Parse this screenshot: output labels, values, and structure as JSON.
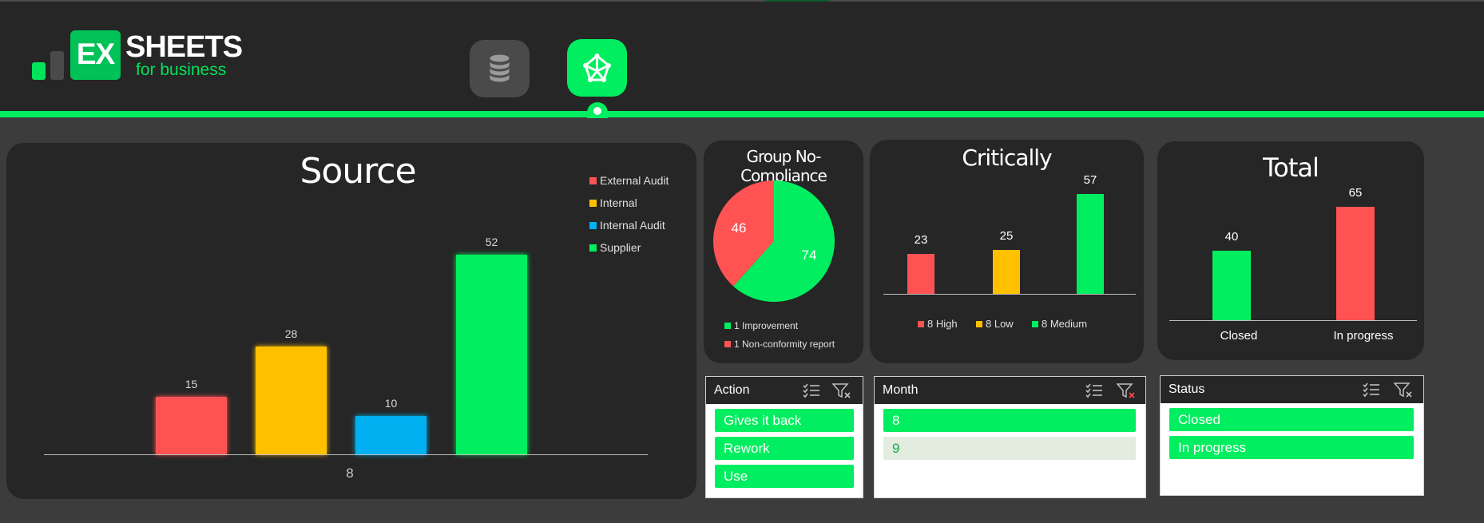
{
  "brand": {
    "logo_ex": "EX",
    "logo_sheets": "SHEETS",
    "logo_sub": "for business"
  },
  "colors": {
    "green": "#00ee5f",
    "red": "#ff5353",
    "yellow": "#ffc000",
    "blue": "#00b0f0",
    "card": "#262626",
    "bg": "#3c3c3c"
  },
  "nav": [
    {
      "icon": "database-icon",
      "active": false
    },
    {
      "icon": "network-icon",
      "active": true
    }
  ],
  "source": {
    "title": "Source",
    "legend": [
      "External Audit",
      "Internal",
      "Internal Audit",
      "Supplier"
    ],
    "axis_label": "8"
  },
  "group": {
    "title": "Group No-Compliance",
    "legend": [
      "1 Improvement",
      "1 Non-conformity report"
    ]
  },
  "critic": {
    "title": "Critically",
    "legend": [
      "8 High",
      "8 Low",
      "8 Medium"
    ]
  },
  "total": {
    "title": "Total",
    "categories": [
      "Closed",
      "In progress"
    ]
  },
  "slicers": {
    "action": {
      "title": "Action",
      "items": [
        "Gives it back",
        "Rework",
        "Use"
      ]
    },
    "month": {
      "title": "Month",
      "items": [
        "8",
        "9"
      ]
    },
    "status": {
      "title": "Status",
      "items": [
        "Closed",
        "In progress"
      ]
    }
  },
  "chart_data": [
    {
      "type": "bar",
      "title": "Source",
      "categories": [
        "8"
      ],
      "series": [
        {
          "name": "External Audit",
          "values": [
            15
          ],
          "color": "#ff5353"
        },
        {
          "name": "Internal",
          "values": [
            28
          ],
          "color": "#ffc000"
        },
        {
          "name": "Internal Audit",
          "values": [
            10
          ],
          "color": "#00b0f0"
        },
        {
          "name": "Supplier",
          "values": [
            52
          ],
          "color": "#00ee5f"
        }
      ],
      "legend": "top-right",
      "grid": false
    },
    {
      "type": "pie",
      "title": "Group No-Compliance",
      "labels": [
        "1 Improvement",
        "1 Non-conformity report"
      ],
      "values": [
        74,
        46
      ],
      "colors": [
        "#00ee5f",
        "#ff5353"
      ],
      "legend": "bottom"
    },
    {
      "type": "bar",
      "title": "Critically",
      "categories": [
        "8 High",
        "8 Low",
        "8 Medium"
      ],
      "values": [
        23,
        25,
        57
      ],
      "colors": [
        "#ff5353",
        "#ffc000",
        "#00ee5f"
      ],
      "legend": "bottom"
    },
    {
      "type": "bar",
      "title": "Total",
      "categories": [
        "Closed",
        "In progress"
      ],
      "values": [
        40,
        65
      ],
      "colors": [
        "#00ee5f",
        "#ff5353"
      ]
    }
  ]
}
